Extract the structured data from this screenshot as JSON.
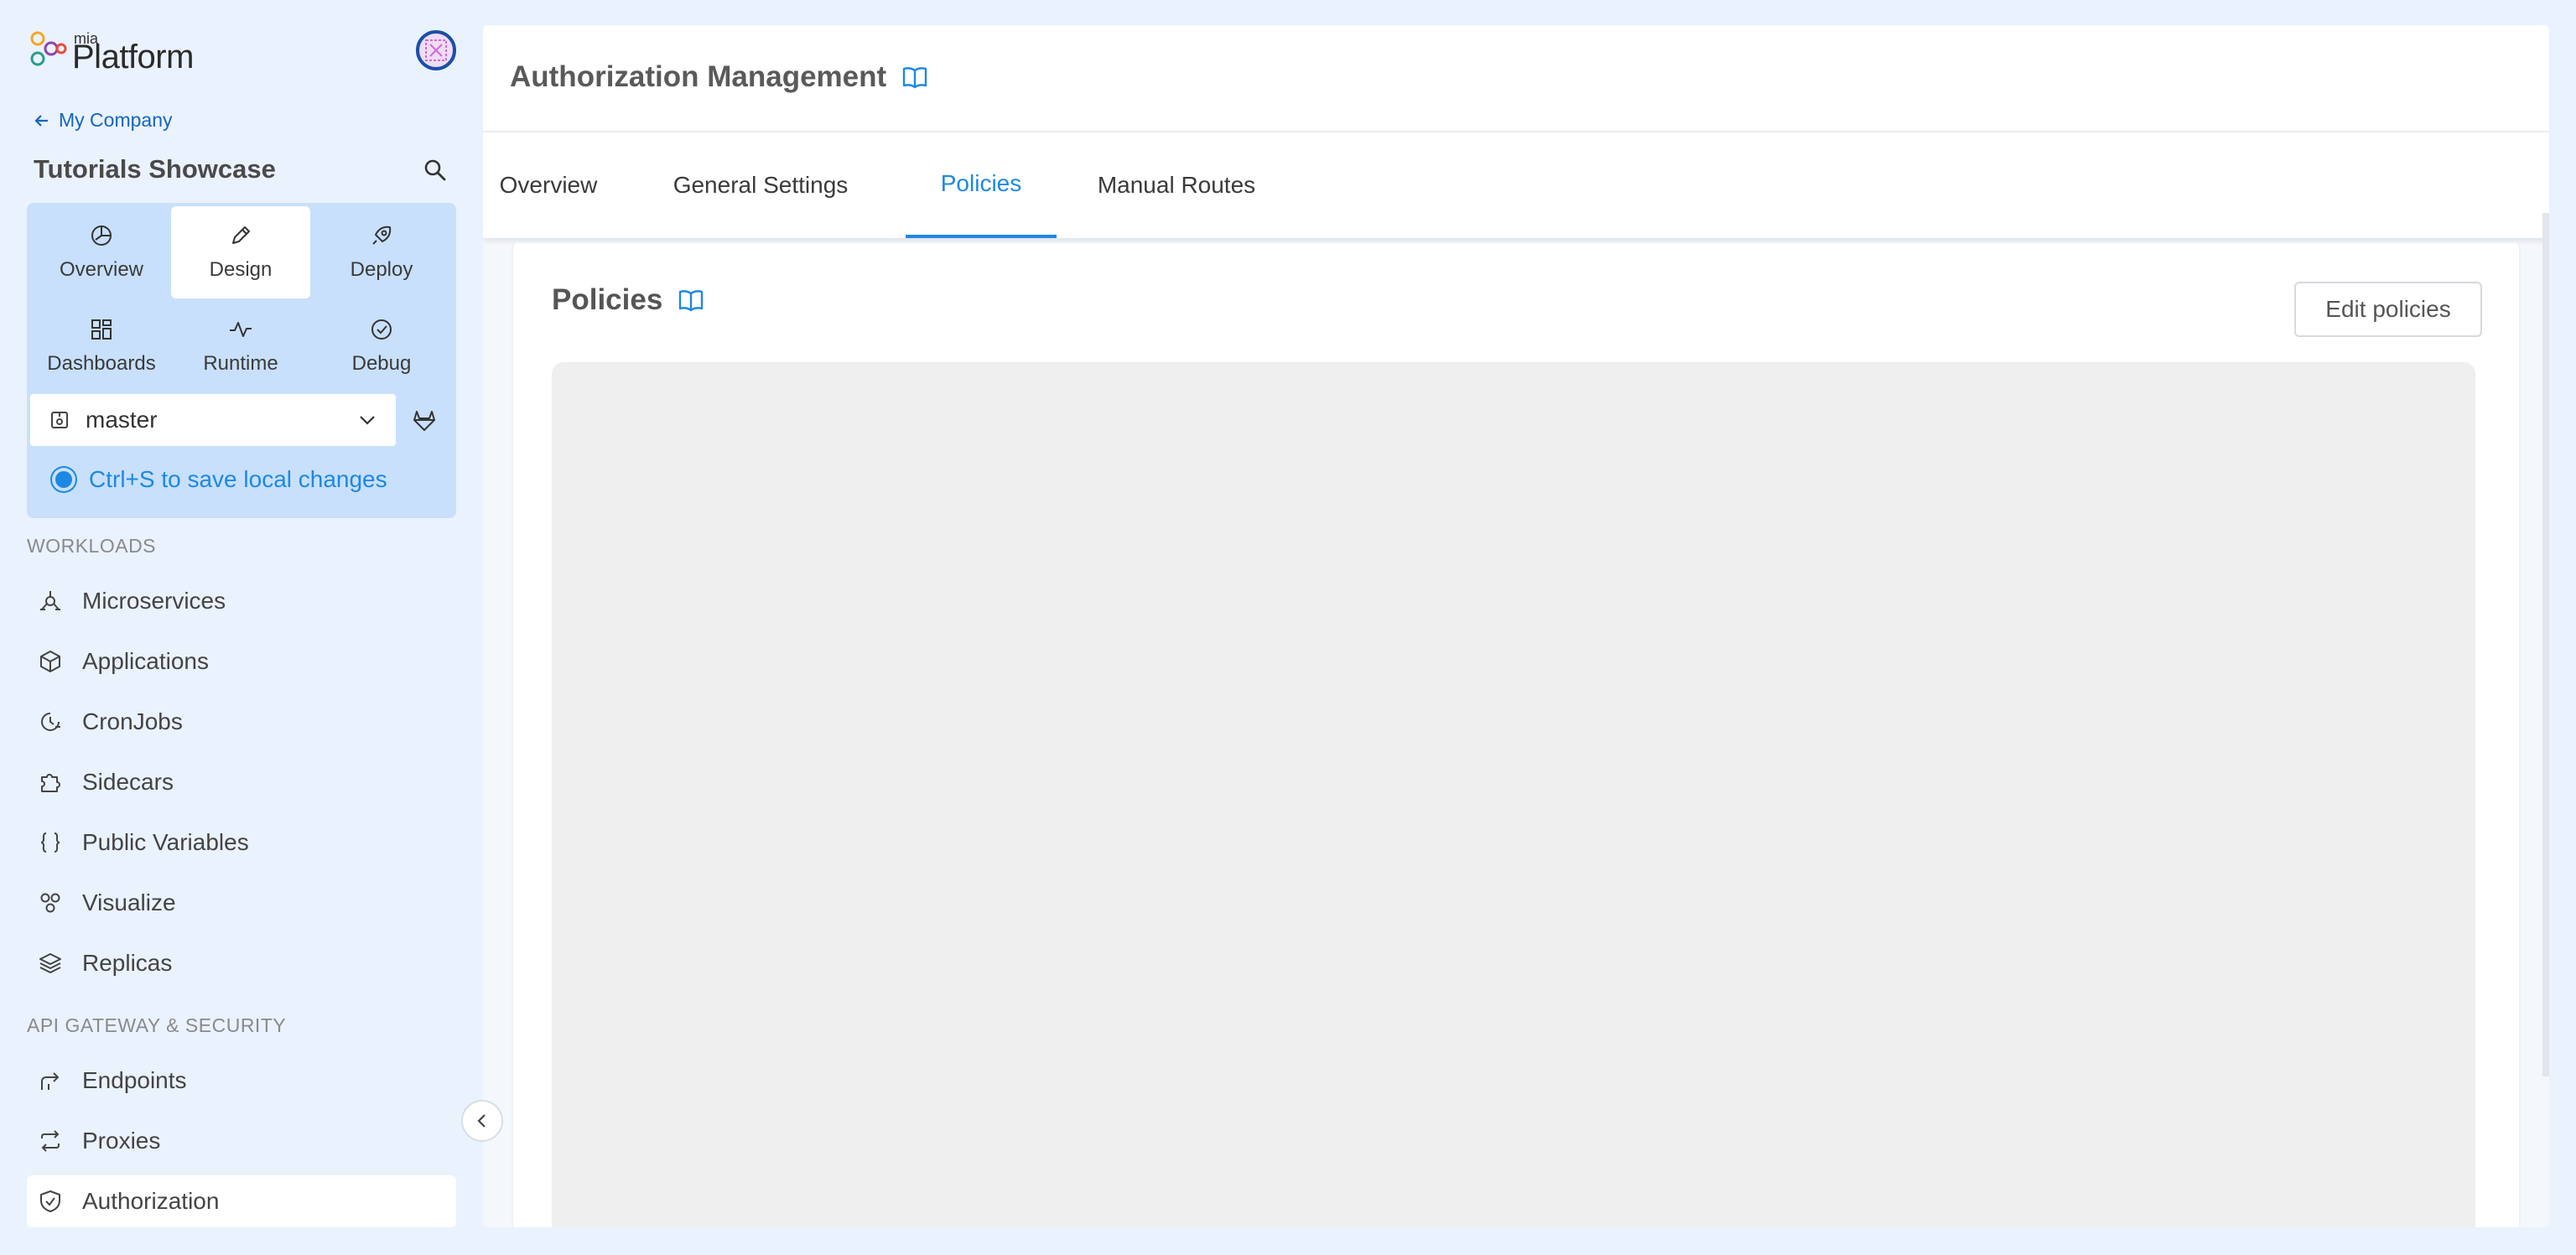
{
  "brand": {
    "line1": "mia",
    "line2": "Platform"
  },
  "back_link": "My Company",
  "project": "Tutorials Showcase",
  "nav_tiles": [
    {
      "label": "Overview",
      "icon": "pie-chart-icon"
    },
    {
      "label": "Design",
      "icon": "pencil-icon",
      "active": true
    },
    {
      "label": "Deploy",
      "icon": "rocket-icon"
    },
    {
      "label": "Dashboards",
      "icon": "grid-icon"
    },
    {
      "label": "Runtime",
      "icon": "activity-icon"
    },
    {
      "label": "Debug",
      "icon": "check-circle-icon"
    }
  ],
  "branch": {
    "value": "master",
    "icon": "branch-icon"
  },
  "save_hint": "Ctrl+S to save local changes",
  "sections": {
    "workloads": "WORKLOADS",
    "api_gateway": "API GATEWAY & SECURITY"
  },
  "workloads_items": [
    {
      "label": "Microservices",
      "icon": "microservice-icon"
    },
    {
      "label": "Applications",
      "icon": "cube-icon"
    },
    {
      "label": "CronJobs",
      "icon": "clock-icon"
    },
    {
      "label": "Sidecars",
      "icon": "puzzle-icon"
    },
    {
      "label": "Public Variables",
      "icon": "braces-icon"
    },
    {
      "label": "Visualize",
      "icon": "nodes-icon"
    },
    {
      "label": "Replicas",
      "icon": "layers-icon"
    }
  ],
  "gateway_items": [
    {
      "label": "Endpoints",
      "icon": "endpoint-icon"
    },
    {
      "label": "Proxies",
      "icon": "swap-icon"
    },
    {
      "label": "Authorization",
      "icon": "shield-icon",
      "active": true
    }
  ],
  "main": {
    "title": "Authorization Management",
    "tabs": [
      "Overview",
      "General Settings",
      "Policies",
      "Manual Routes"
    ],
    "active_tab": "Policies",
    "card_title": "Policies",
    "edit_button": "Edit policies"
  },
  "colors": {
    "accent": "#1e88e5",
    "sidebar_bg": "#eaf2fe",
    "nav_panel": "#c8e0fb",
    "link": "#1565c0"
  }
}
